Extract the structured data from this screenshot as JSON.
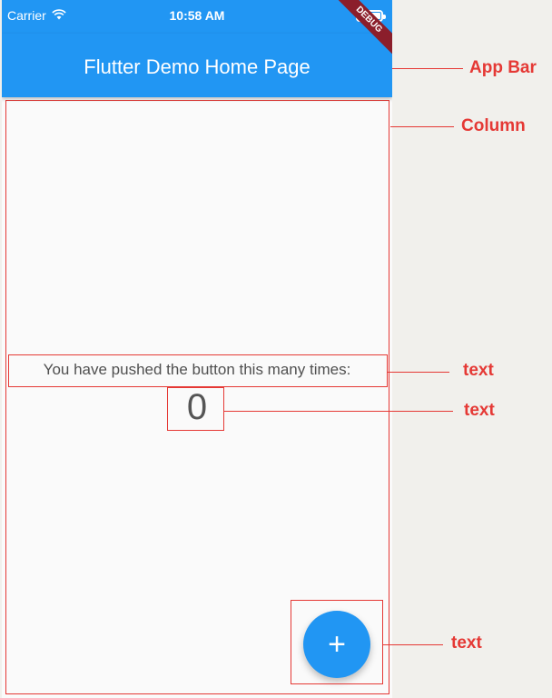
{
  "status_bar": {
    "carrier": "Carrier",
    "time": "10:58 AM",
    "wifi_icon": "wifi-icon",
    "battery_icon": "battery-icon"
  },
  "app_bar": {
    "title": "Flutter Demo Home Page",
    "debug_banner": "DEBUG",
    "color": "#2196f3"
  },
  "body": {
    "message": "You have pushed the button this many times:",
    "counter": "0"
  },
  "fab": {
    "icon": "plus-icon",
    "label": "+",
    "color": "#2196f3"
  },
  "annotations": {
    "app_bar_label": "App Bar",
    "column_label": "Column",
    "message_label": "text",
    "counter_label": "text",
    "fab_label": "text",
    "color": "#e53935"
  }
}
